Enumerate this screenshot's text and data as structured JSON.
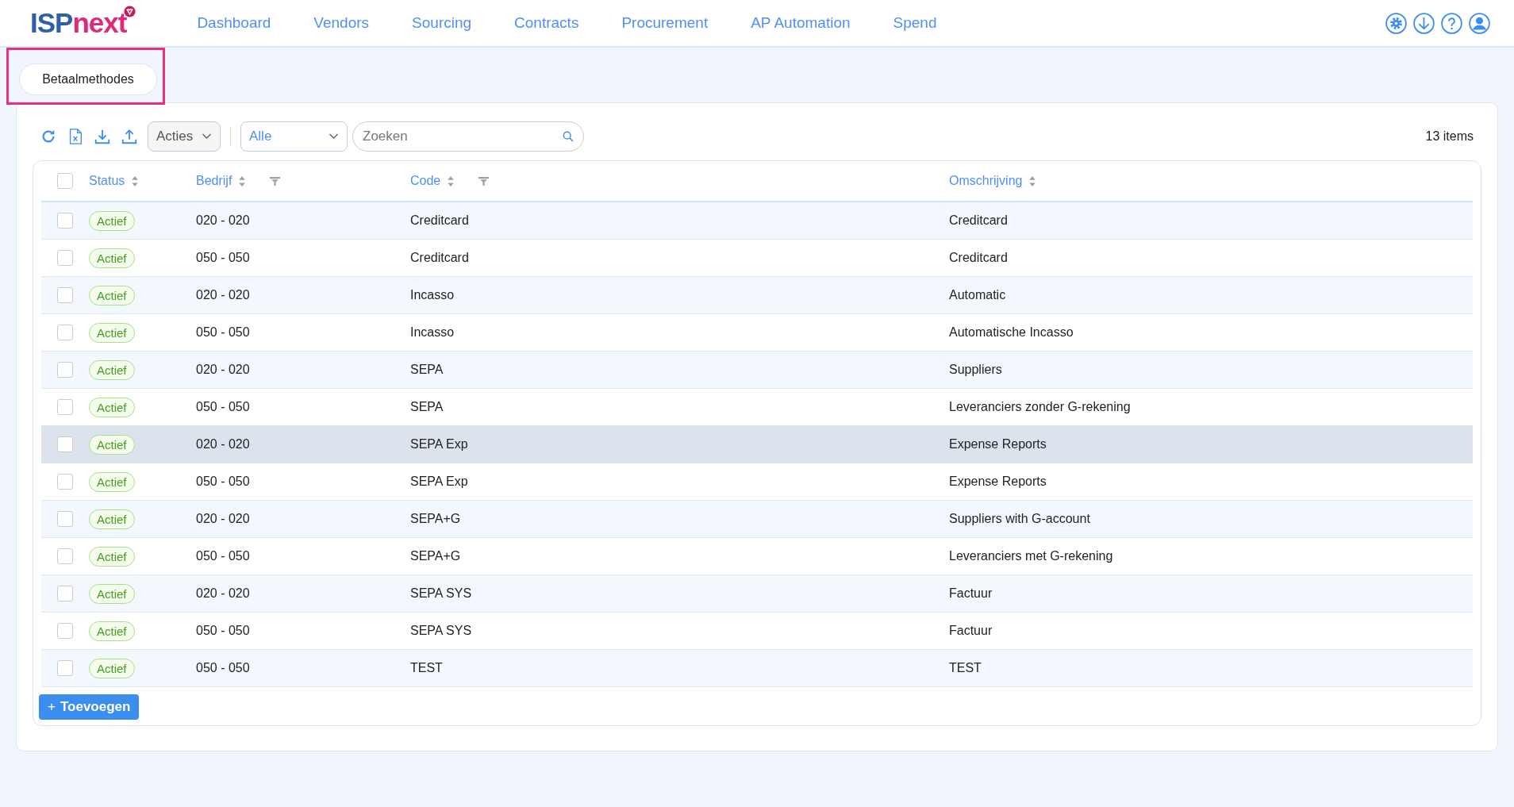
{
  "header": {
    "logo": {
      "part_1": "ISP",
      "part_2": "next"
    },
    "nav": [
      {
        "label": "Dashboard"
      },
      {
        "label": "Vendors"
      },
      {
        "label": "Sourcing"
      },
      {
        "label": "Contracts"
      },
      {
        "label": "Procurement"
      },
      {
        "label": "AP Automation"
      },
      {
        "label": "Spend"
      }
    ]
  },
  "page_tab": {
    "label": "Betaalmethodes",
    "highlighted": true
  },
  "toolbar": {
    "actions": "Acties",
    "filter": "Alle",
    "search": {
      "placeholder": "Zoeken"
    },
    "count": "13 items"
  },
  "table": {
    "select_all_checked": false,
    "columns": [
      {
        "label": "Status",
        "kind": "sortable"
      },
      {
        "label": "Bedrijf",
        "kind": "filterable"
      },
      {
        "label": "Code",
        "kind": "filterable"
      },
      {
        "label": "Omschrijving",
        "kind": "sortable"
      }
    ],
    "rows": [
      {
        "status": "Actief",
        "company": "020 - 020",
        "code": "Creditcard",
        "description": "Creditcard",
        "checked": false,
        "highlighted": false
      },
      {
        "status": "Actief",
        "company": "050 - 050",
        "code": "Creditcard",
        "description": "Creditcard",
        "checked": false,
        "highlighted": false
      },
      {
        "status": "Actief",
        "company": "020 - 020",
        "code": "Incasso",
        "description": "Automatic",
        "checked": false,
        "highlighted": false
      },
      {
        "status": "Actief",
        "company": "050 - 050",
        "code": "Incasso",
        "description": "Automatische Incasso",
        "checked": false,
        "highlighted": false
      },
      {
        "status": "Actief",
        "company": "020 - 020",
        "code": "SEPA",
        "description": "Suppliers",
        "checked": false,
        "highlighted": false
      },
      {
        "status": "Actief",
        "company": "050 - 050",
        "code": "SEPA",
        "description": "Leveranciers zonder G-rekening",
        "checked": false,
        "highlighted": false
      },
      {
        "status": "Actief",
        "company": "020 - 020",
        "code": "SEPA Exp",
        "description": "Expense Reports",
        "checked": false,
        "highlighted": true
      },
      {
        "status": "Actief",
        "company": "050 - 050",
        "code": "SEPA Exp",
        "description": "Expense Reports",
        "checked": false,
        "highlighted": false
      },
      {
        "status": "Actief",
        "company": "020 - 020",
        "code": "SEPA+G",
        "description": "Suppliers with G-account",
        "checked": false,
        "highlighted": false
      },
      {
        "status": "Actief",
        "company": "050 - 050",
        "code": "SEPA+G",
        "description": "Leveranciers met G-rekening",
        "checked": false,
        "highlighted": false
      },
      {
        "status": "Actief",
        "company": "020 - 020",
        "code": "SEPA SYS",
        "description": "Factuur",
        "checked": false,
        "highlighted": false
      },
      {
        "status": "Actief",
        "company": "050 - 050",
        "code": "SEPA SYS",
        "description": "Factuur",
        "checked": false,
        "highlighted": false
      },
      {
        "status": "Actief",
        "company": "050 - 050",
        "code": "TEST",
        "description": "TEST",
        "checked": false,
        "highlighted": false
      }
    ]
  },
  "add_button": {
    "icon": "+",
    "label": "Toevoegen"
  }
}
